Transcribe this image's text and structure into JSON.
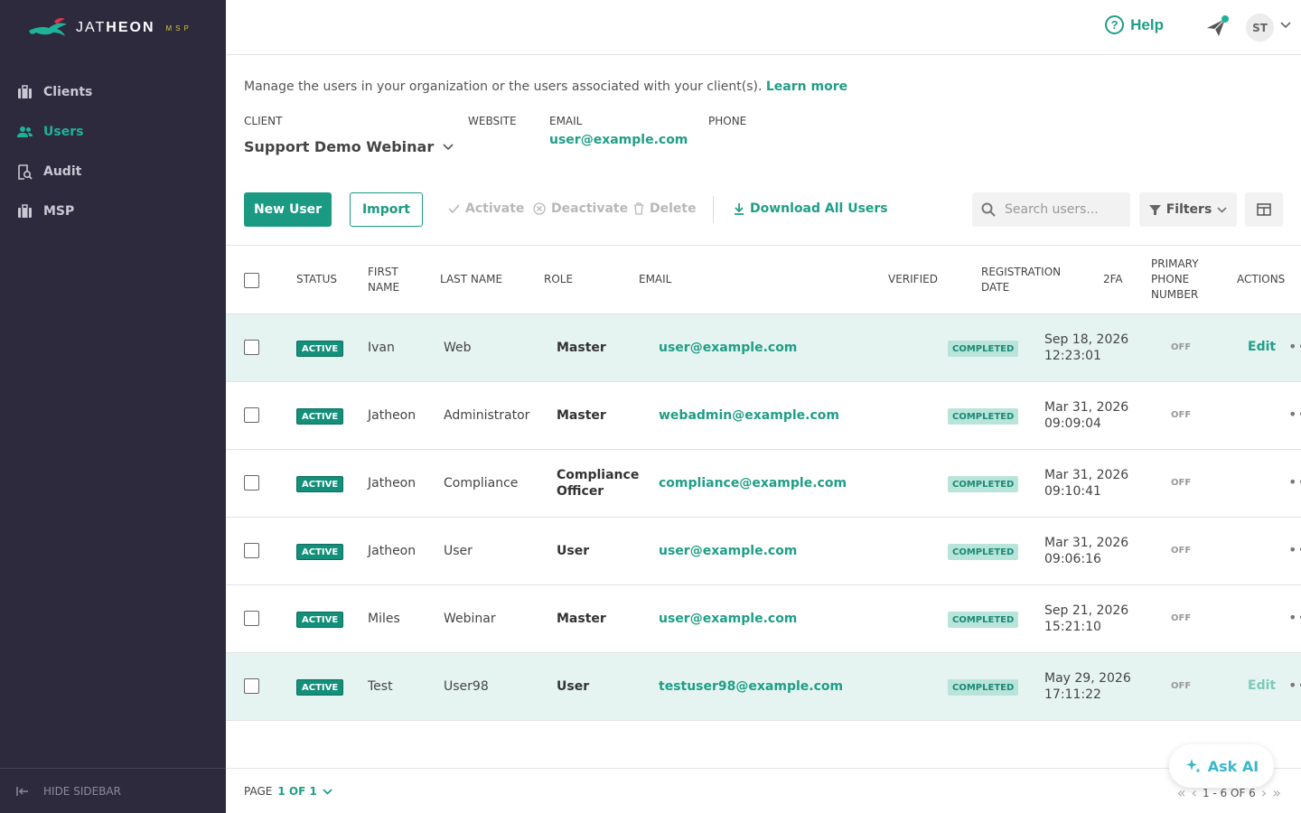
{
  "brand": {
    "name_light": "JAT",
    "name_bold": "HEON",
    "suffix": "MSP"
  },
  "sidebar": {
    "items": [
      {
        "label": "Clients",
        "icon": "clients-icon"
      },
      {
        "label": "Users",
        "icon": "users-icon"
      },
      {
        "label": "Audit",
        "icon": "audit-icon"
      },
      {
        "label": "MSP",
        "icon": "msp-icon"
      }
    ],
    "hide": "HIDE SIDEBAR"
  },
  "topbar": {
    "help": "Help",
    "avatar": "ST"
  },
  "intro": {
    "text": "Manage the users in your organization or the users associated with your client(s).",
    "link": "Learn more"
  },
  "info": {
    "client_label": "CLIENT",
    "client_value": "Support Demo Webinar",
    "website_label": "WEBSITE",
    "email_label": "EMAIL",
    "email_value": "user@example.com",
    "phone_label": "PHONE"
  },
  "toolbar": {
    "new_user": "New User",
    "import": "Import",
    "activate": "Activate",
    "deactivate": "Deactivate",
    "delete": "Delete",
    "download": "Download All Users",
    "search_placeholder": "Search users...",
    "filters": "Filters"
  },
  "table": {
    "headers": {
      "status": "STATUS",
      "first_name_1": "FIRST",
      "first_name_2": "NAME",
      "last_name": "LAST NAME",
      "role": "ROLE",
      "email": "EMAIL",
      "verified": "VERIFIED",
      "reg_1": "REGISTRATION",
      "reg_2": "DATE",
      "twofa": "2FA",
      "phone_1": "PRIMARY",
      "phone_2": "PHONE",
      "phone_3": "NUMBER",
      "actions": "ACTIONS"
    },
    "rows": [
      {
        "status": "ACTIVE",
        "first": "Ivan",
        "last": "Web",
        "role_1": "Master",
        "role_2": "",
        "email": "user@example.com",
        "verified": "COMPLETED",
        "date": "Sep 18, 2026",
        "time": "12:23:01",
        "twofa": "OFF",
        "edit": "Edit"
      },
      {
        "status": "ACTIVE",
        "first": "Jatheon",
        "last": "Administrator",
        "role_1": "Master",
        "role_2": "",
        "email": "webadmin@example.com",
        "verified": "COMPLETED",
        "date": "Mar 31, 2026",
        "time": "09:09:04",
        "twofa": "OFF",
        "edit": ""
      },
      {
        "status": "ACTIVE",
        "first": "Jatheon",
        "last": "Compliance",
        "role_1": "Compliance",
        "role_2": "Officer",
        "email": "compliance@example.com",
        "verified": "COMPLETED",
        "date": "Mar 31, 2026",
        "time": "09:10:41",
        "twofa": "OFF",
        "edit": ""
      },
      {
        "status": "ACTIVE",
        "first": "Jatheon",
        "last": "User",
        "role_1": "User",
        "role_2": "",
        "email": "user@example.com",
        "verified": "COMPLETED",
        "date": "Mar 31, 2026",
        "time": "09:06:16",
        "twofa": "OFF",
        "edit": ""
      },
      {
        "status": "ACTIVE",
        "first": "Miles",
        "last": "Webinar",
        "role_1": "Master",
        "role_2": "",
        "email": "user@example.com",
        "verified": "COMPLETED",
        "date": "Sep 21, 2026",
        "time": "15:21:10",
        "twofa": "OFF",
        "edit": ""
      },
      {
        "status": "ACTIVE",
        "first": "Test",
        "last": "User98",
        "role_1": "User",
        "role_2": "",
        "email": "testuser98@example.com",
        "verified": "COMPLETED",
        "date": "May 29, 2026",
        "time": "17:11:22",
        "twofa": "OFF",
        "edit": "Edit"
      }
    ]
  },
  "footer": {
    "page_label": "PAGE",
    "page_value": "1 OF 1",
    "ask_ai": "Ask AI",
    "range": "1 - 6 OF 6"
  },
  "colors": {
    "accent": "#1a9a83",
    "sidebar_bg": "#2d2a3e",
    "row_highlight": "#e6f4f1"
  }
}
